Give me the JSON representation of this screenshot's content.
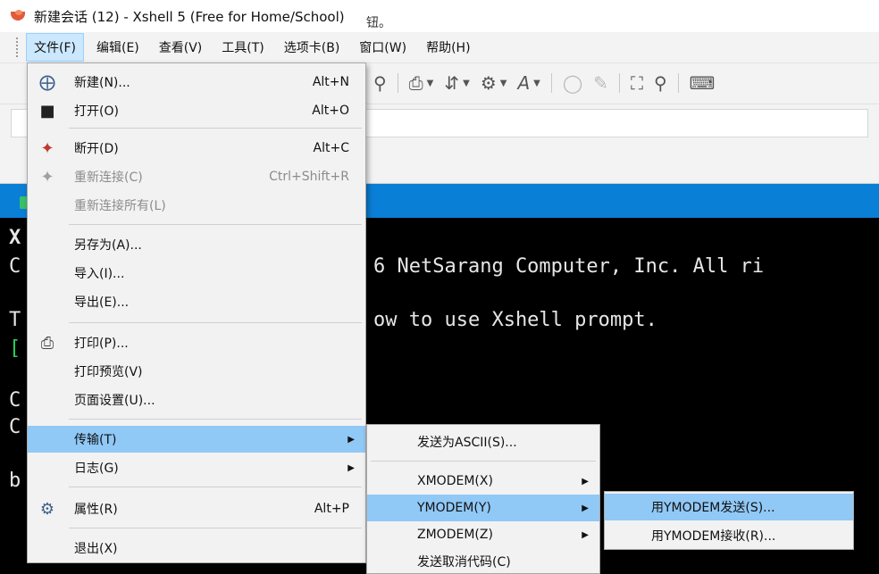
{
  "window": {
    "title": "新建会话 (12) - Xshell 5 (Free for Home/School)"
  },
  "menubar": {
    "items": [
      {
        "label": "文件(F)",
        "active": true
      },
      {
        "label": "编辑(E)"
      },
      {
        "label": "查看(V)"
      },
      {
        "label": "工具(T)"
      },
      {
        "label": "选项卡(B)"
      },
      {
        "label": "窗口(W)"
      },
      {
        "label": "帮助(H)"
      }
    ]
  },
  "toolbar": {
    "icons": [
      "search-icon",
      "print-icon",
      "transfer-icon",
      "globe-icon",
      "font-icon",
      "disconnect-icon",
      "lock-icon",
      "fullscreen-icon",
      "keyboard-icon"
    ]
  },
  "address_hint": "钮。",
  "terminal": {
    "lines": [
      "X",
      "C",
      "6 NetSarang Computer, Inc. All ri",
      "T",
      "ow to use Xshell prompt.",
      "[",
      "C",
      "C",
      "b"
    ]
  },
  "file_menu": {
    "items": [
      {
        "label": "新建(N)...",
        "shortcut": "Alt+N",
        "icon": "new-session-icon"
      },
      {
        "label": "打开(O)",
        "shortcut": "Alt+O",
        "icon": "open-folder-icon"
      },
      {
        "label": "断开(D)",
        "shortcut": "Alt+C",
        "icon": "disconnect-icon"
      },
      {
        "label": "重新连接(C)",
        "shortcut": "Ctrl+Shift+R",
        "icon": "reconnect-icon",
        "disabled": true
      },
      {
        "label": "重新连接所有(L)",
        "disabled": true
      },
      {
        "label": "另存为(A)..."
      },
      {
        "label": "导入(I)..."
      },
      {
        "label": "导出(E)..."
      },
      {
        "label": "打印(P)...",
        "icon": "printer-icon"
      },
      {
        "label": "打印预览(V)"
      },
      {
        "label": "页面设置(U)..."
      },
      {
        "label": "传输(T)",
        "submenu": true,
        "highlighted": true
      },
      {
        "label": "日志(G)",
        "submenu": true
      },
      {
        "label": "属性(R)",
        "shortcut": "Alt+P",
        "icon": "properties-icon"
      },
      {
        "label": "退出(X)"
      }
    ]
  },
  "transfer_menu": {
    "items": [
      {
        "label": "发送为ASCII(S)..."
      },
      {
        "label": "XMODEM(X)",
        "submenu": true
      },
      {
        "label": "YMODEM(Y)",
        "submenu": true,
        "highlighted": true
      },
      {
        "label": "ZMODEM(Z)",
        "submenu": true
      },
      {
        "label": "发送取消代码(C)"
      }
    ]
  },
  "ymodem_menu": {
    "items": [
      {
        "label": "用YMODEM发送(S)...",
        "highlighted": true
      },
      {
        "label": "用YMODEM接收(R)..."
      }
    ]
  },
  "colors": {
    "tab_strip": "#0a7fd6",
    "menu_highlight": "#90c8f6",
    "terminal_bg": "#000000",
    "terminal_fg": "#e6e6e6",
    "prompt_green": "#25d05a"
  }
}
